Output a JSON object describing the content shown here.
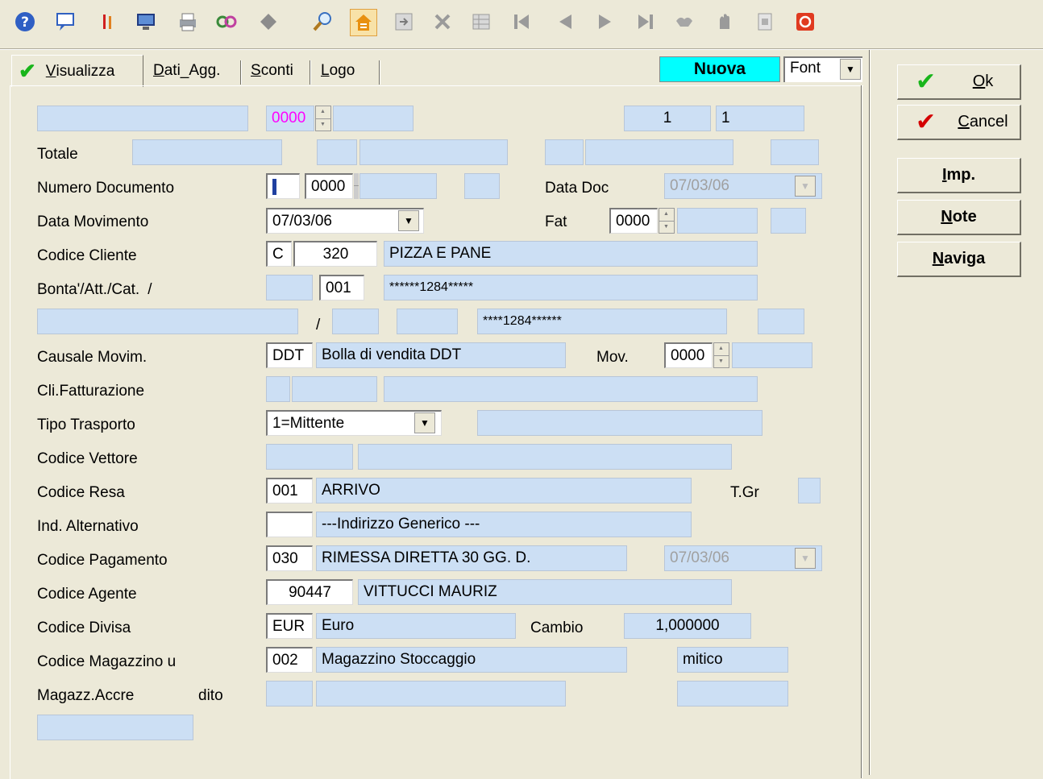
{
  "toolbar": {
    "icons": [
      "help-icon",
      "comment-icon",
      "marker-icon",
      "monitor-icon",
      "printer-icon",
      "link-icon",
      "diamond-icon",
      "search-icon",
      "home-icon",
      "export-icon",
      "delete-icon",
      "grid-icon",
      "first-icon",
      "prev-icon",
      "next-icon",
      "last-icon",
      "handshake-icon",
      "hand-icon",
      "document-icon",
      "stop-icon"
    ]
  },
  "tabs": {
    "visualizza": {
      "u": "V",
      "rest": "isualizza"
    },
    "dati_agg": {
      "u": "D",
      "rest": "ati_Agg."
    },
    "sconti": {
      "u": "S",
      "rest": "conti"
    },
    "logo": {
      "u": "L",
      "rest": "ogo"
    }
  },
  "status": "Nuova",
  "font_select": "Font",
  "buttons": {
    "ok": {
      "u": "O",
      "rest": "k"
    },
    "cancel": {
      "u": "C",
      "rest": "ancel"
    },
    "imp": {
      "u": "I",
      "rest": "mp."
    },
    "note": {
      "u": "N",
      "rest": "ote"
    },
    "naviga": {
      "u": "N",
      "rest": "aviga"
    }
  },
  "labels": {
    "totale": "Totale",
    "numero_documento": "Numero Documento",
    "data_doc": "Data Doc",
    "data_movimento": "Data Movimento",
    "fat": "Fat",
    "codice_cliente": "Codice Cliente",
    "bonta": "Bonta'/Att./Cat.",
    "bonta_slash": "/",
    "row8_slash": "/",
    "causale": "Causale Movim.",
    "mov": "Mov.",
    "cli_fatt": "Cli.Fatturazione",
    "tipo_trasporto": "Tipo Trasporto",
    "codice_vettore": "Codice Vettore",
    "codice_resa": "Codice Resa",
    "tgr": "T.Gr",
    "ind_alt": "Ind. Alternativo",
    "codice_pagamento": "Codice Pagamento",
    "codice_agente": "Codice Agente",
    "codice_divisa": "Codice Divisa",
    "cambio": "Cambio",
    "codice_magazzino": "Codice Magazzino u",
    "magazz_accre": "Magazz.Accre",
    "dito": "dito"
  },
  "values": {
    "top_year": "0000",
    "top_n1": "1",
    "top_n2": "1",
    "numdoc_year": "0000",
    "data_doc": "07/03/06",
    "data_movimento": "07/03/06",
    "fat_year": "0000",
    "cliente_type": "C",
    "cliente_code": "320",
    "cliente_name": "PIZZA E PANE",
    "bonta_code": "001",
    "bonta_desc": "******1284*****",
    "row8_desc": "****1284******",
    "causale_code": "DDT",
    "causale_desc": "Bolla di vendita DDT",
    "mov_year": "0000",
    "tipo_trasporto": "1=Mittente",
    "resa_code": "001",
    "resa_desc": "ARRIVO",
    "ind_alt_desc": "---Indirizzo Generico ---",
    "pagamento_code": "030",
    "pagamento_desc": "RIMESSA DIRETTA 30 GG. D.",
    "pagamento_date": "07/03/06",
    "agente_code": "90447",
    "agente_name": "VITTUCCI MAURIZ",
    "divisa_code": "EUR",
    "divisa_desc": "Euro",
    "cambio": "1,000000",
    "magazzino_code": "002",
    "magazzino_desc": "Magazzino Stoccaggio",
    "magazzino_extra": "mitico"
  }
}
